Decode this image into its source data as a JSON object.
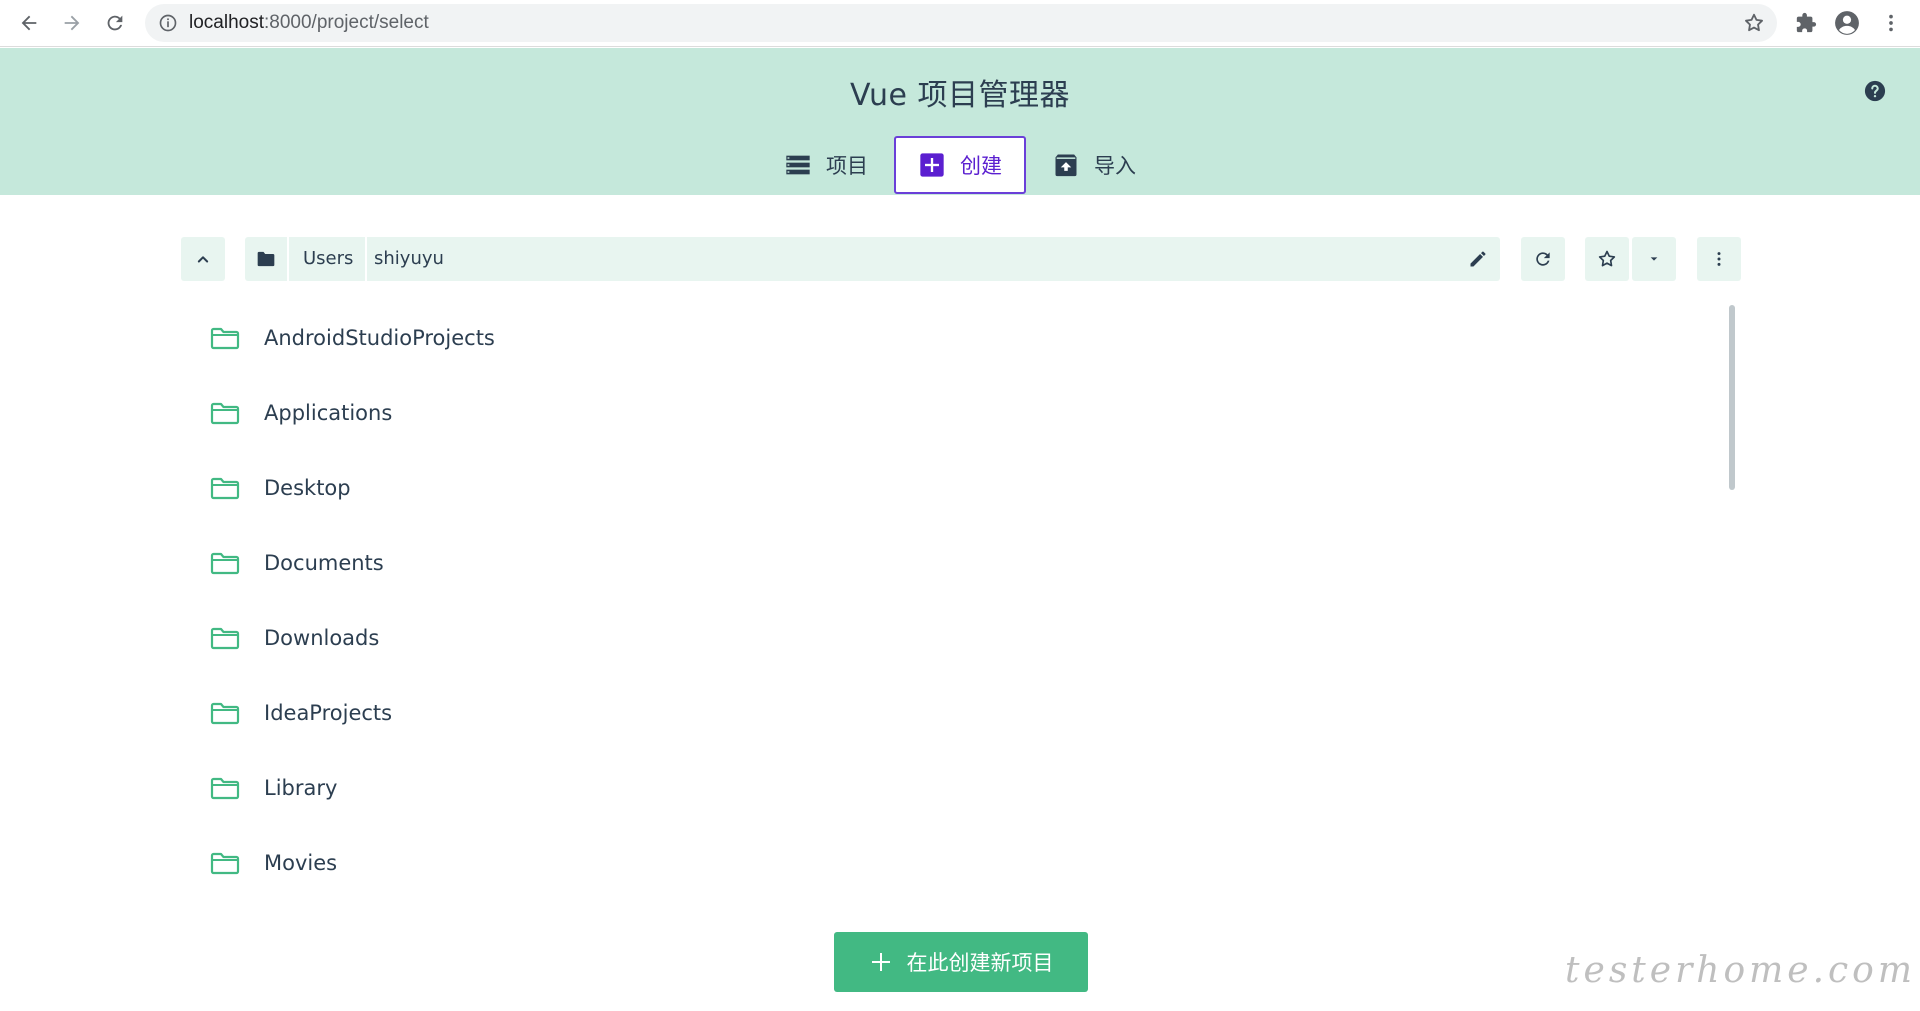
{
  "browser": {
    "url_host": "localhost",
    "url_path": ":8000/project/select"
  },
  "app": {
    "title": "Vue 项目管理器",
    "tabs": [
      {
        "label": "项目",
        "icon": "list-icon",
        "active": false
      },
      {
        "label": "创建",
        "icon": "add-box-icon",
        "active": true
      },
      {
        "label": "导入",
        "icon": "unarchive-icon",
        "active": false
      }
    ]
  },
  "path": {
    "segments": [
      "Users",
      "shiyuyu"
    ]
  },
  "folders": [
    "AndroidStudioProjects",
    "Applications",
    "Desktop",
    "Documents",
    "Downloads",
    "IdeaProjects",
    "Library",
    "Movies"
  ],
  "actions": {
    "create_here_label": "在此创建新项目"
  },
  "watermark": "testerhome.com",
  "colors": {
    "header_bg": "#c5e8db",
    "accent_green": "#42b983",
    "active_tab": "#5b1fd0",
    "pathbar_bg": "#e8f5f0"
  }
}
